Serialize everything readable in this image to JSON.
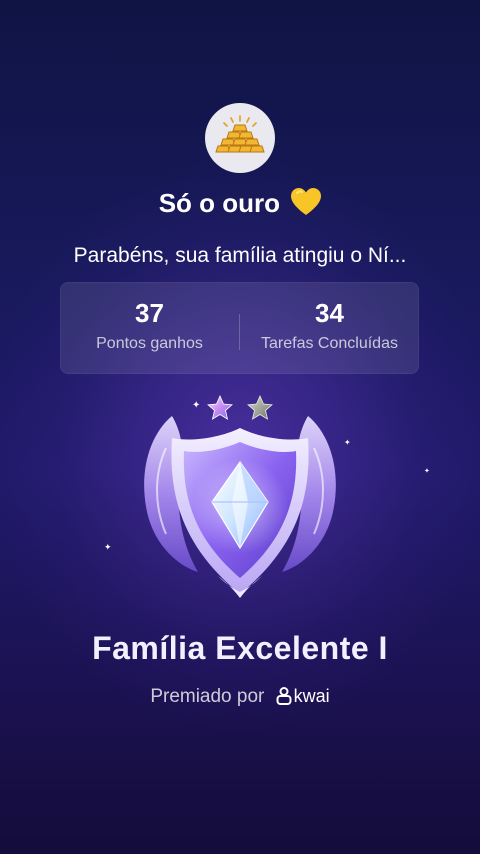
{
  "family": {
    "avatar_icon": "gold-bars-icon",
    "name": "Só o ouro",
    "name_emoji_icon": "yellow-heart-icon",
    "congrats_text": "Parabéns, sua família atingiu o Ní..."
  },
  "stats": {
    "points_value": "37",
    "points_label": "Pontos ganhos",
    "tasks_value": "34",
    "tasks_label": "Tarefas Concluídas"
  },
  "badge": {
    "icon": "shield-crystal-badge-icon",
    "stars_icon": "star-icon",
    "stars_filled": 1,
    "stars_total": 2,
    "level_title": "Família Excelente I"
  },
  "award": {
    "prefix": "Premiado por",
    "brand_icon": "kwai-logo-icon",
    "brand": "kwai"
  },
  "colors": {
    "background_top": "#101444",
    "background_bottom": "#140c3a",
    "card_background": "rgba(255,255,255,0.10)",
    "heart": "#f5c518",
    "gold": "#e8a92a"
  }
}
